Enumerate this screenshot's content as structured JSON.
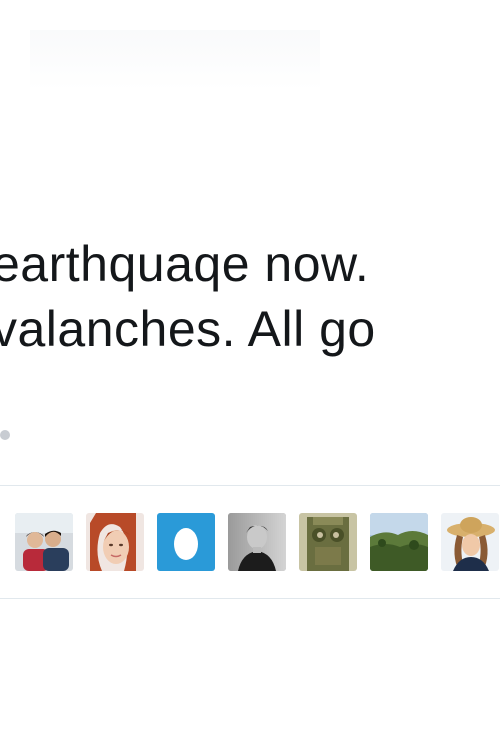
{
  "tweet": {
    "lines": [
      "earthquaqe now.",
      "valanches. All go"
    ]
  },
  "likers": {
    "avatars": [
      {
        "name": "couple-photo-avatar",
        "accent": "#c83838"
      },
      {
        "name": "woman-redhead-avatar",
        "accent": "#c65a35"
      },
      {
        "name": "egg-default-avatar",
        "accent": "#2a9ad8"
      },
      {
        "name": "man-monochrome-avatar",
        "accent": "#5c5c5c"
      },
      {
        "name": "statue-photo-avatar",
        "accent": "#6c7440"
      },
      {
        "name": "landscape-photo-avatar",
        "accent": "#4d6a2c"
      },
      {
        "name": "woman-hat-avatar",
        "accent": "#d8b06c"
      }
    ]
  }
}
